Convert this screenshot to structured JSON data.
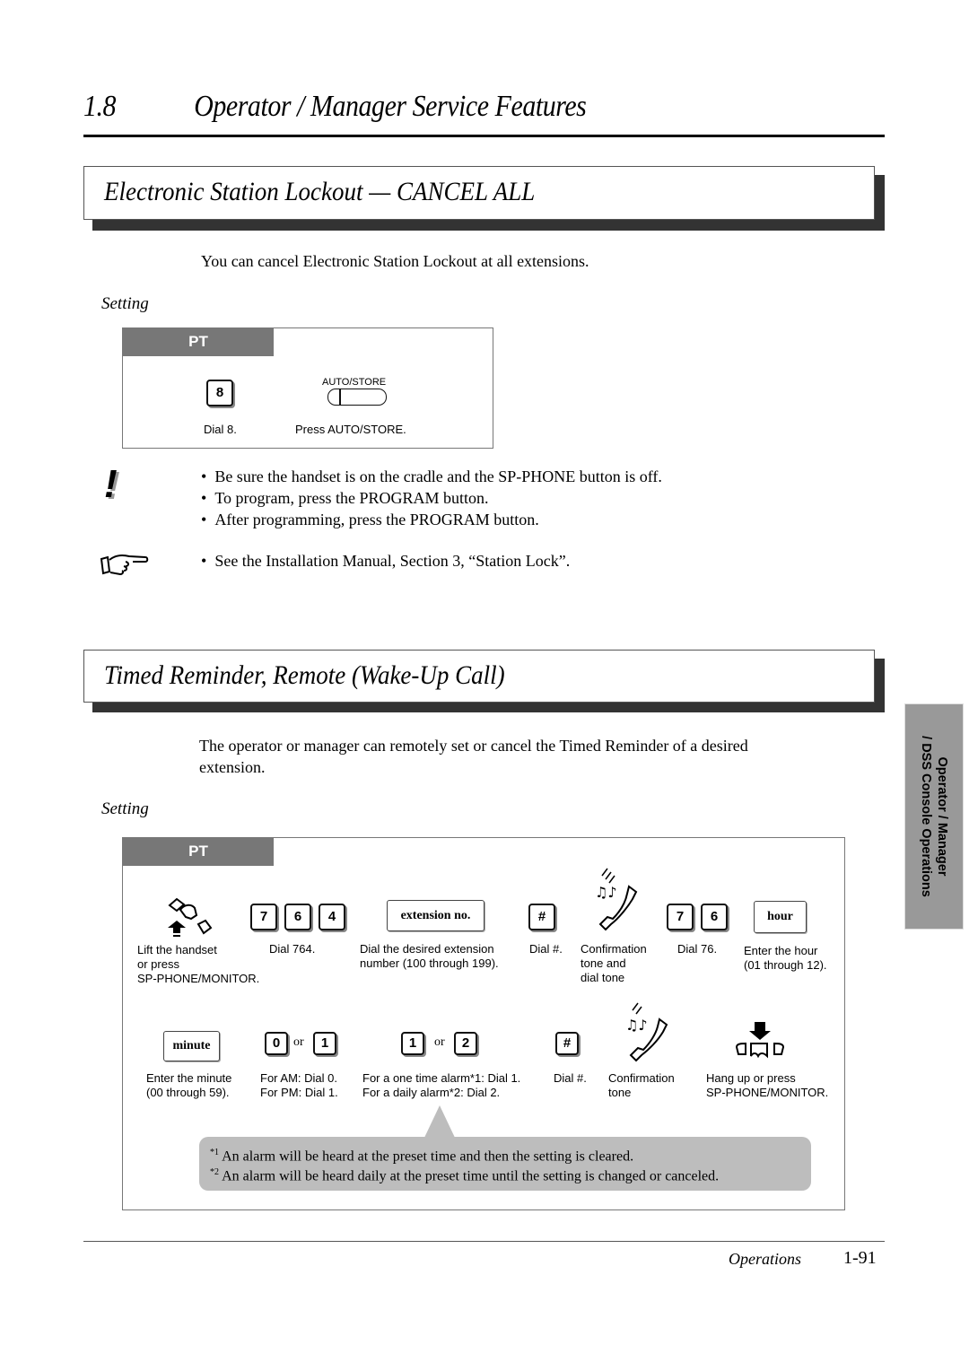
{
  "chapter": {
    "number": "1.8",
    "title": "Operator / Manager Service Features"
  },
  "section1": {
    "title": "Electronic Station Lockout — CANCEL ALL",
    "intro": "You can cancel Electronic Station Lockout at all extensions.",
    "setting_label": "Setting",
    "pt_label": "PT",
    "steps": [
      {
        "key": "8",
        "caption": "Dial 8."
      },
      {
        "button_label": "AUTO/STORE",
        "caption": "Press AUTO/STORE."
      }
    ],
    "caution_icon": "exclamation-icon",
    "cautions": [
      "Be sure the handset is on the cradle and the SP-PHONE button is off.",
      "To program, press the PROGRAM button.",
      "After programming, press the PROGRAM button."
    ],
    "reference_icon": "pointing-hand-icon",
    "reference": "See the Installation Manual, Section 3, “Station Lock”."
  },
  "section2": {
    "title": "Timed Reminder, Remote (Wake-Up Call)",
    "intro_line1": "The operator or manager can remotely set or cancel the Timed Reminder of a desired",
    "intro_line2": "extension.",
    "setting_label": "Setting",
    "pt_label": "PT",
    "row1": {
      "lift": {
        "caption": [
          "Lift the handset",
          "or press",
          "SP-PHONE/MONITOR."
        ]
      },
      "dial764": {
        "keys": [
          "7",
          "6",
          "4"
        ],
        "caption": "Dial 764."
      },
      "ext": {
        "field": "extension no.",
        "caption": [
          "Dial the desired extension",
          "number (100 through 199)."
        ]
      },
      "hash": {
        "key": "#",
        "caption": "Dial #."
      },
      "tone": {
        "caption": [
          "Confirmation",
          "tone and",
          "dial tone"
        ]
      },
      "dial76": {
        "keys": [
          "7",
          "6"
        ],
        "caption": "Dial 76."
      },
      "hour": {
        "field": "hour",
        "caption": [
          "Enter the hour",
          "(01 through 12)."
        ]
      }
    },
    "row2": {
      "minute": {
        "field": "minute",
        "caption": [
          "Enter the minute",
          "(00 through 59)."
        ]
      },
      "ampm": {
        "keys": [
          "0",
          "1"
        ],
        "or": "or",
        "caption": [
          "For AM: Dial 0.",
          "For PM: Dial 1."
        ]
      },
      "alarm": {
        "keys": [
          "1",
          "2"
        ],
        "or": "or",
        "caption": [
          "For a one time alarm*1: Dial 1.",
          "For a daily alarm*2: Dial 2."
        ]
      },
      "hash": {
        "key": "#",
        "caption": "Dial #."
      },
      "tone": {
        "caption": [
          "Confirmation",
          "tone"
        ]
      },
      "hangup": {
        "caption": [
          "Hang up or press",
          "SP-PHONE/MONITOR."
        ]
      }
    },
    "notes": [
      {
        "mark": "*1",
        "text": "An alarm will be heard at the preset time and then the setting is cleared."
      },
      {
        "mark": "*2",
        "text": "An alarm will be heard daily at the preset time until the setting is changed or canceled."
      }
    ]
  },
  "side_tab": {
    "line1": "Operator / Manager",
    "line2": "/ DSS Console Operations"
  },
  "footer": {
    "section": "Operations",
    "page": "1-91"
  }
}
